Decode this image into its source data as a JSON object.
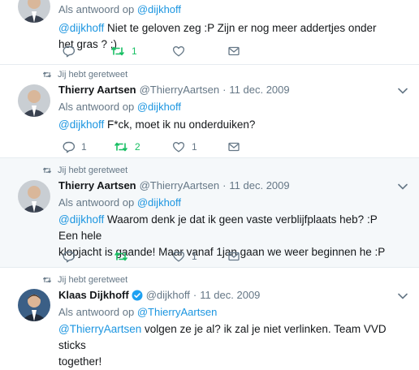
{
  "tweet1": {
    "reply_prefix": "Als antwoord op",
    "reply_handle": "@dijkhoff",
    "text_mention": "@dijkhoff",
    "text": "Niet te geloven zeg :P Zijn er nog meer addertjes onder het gras ? ;)",
    "retweet_count": "1"
  },
  "tweet2": {
    "retweeted_label": "Jij hebt geretweet",
    "name": "Thierry Aartsen",
    "handle": "@ThierryAartsen",
    "sep": "·",
    "date": "11 dec. 2009",
    "reply_prefix": "Als antwoord op",
    "reply_handle": "@dijkhoff",
    "text_mention": "@dijkhoff",
    "text": "F*ck, moet ik nu onderduiken?",
    "reply_count": "1",
    "retweet_count": "2",
    "like_count": "1"
  },
  "tweet3": {
    "retweeted_label": "Jij hebt geretweet",
    "name": "Thierry Aartsen",
    "handle": "@ThierryAartsen",
    "sep": "·",
    "date": "11 dec. 2009",
    "reply_prefix": "Als antwoord op",
    "reply_handle": "@dijkhoff",
    "text_mention": "@dijkhoff",
    "text_line1": "Waarom denk je dat ik geen vaste verblijfplaats heb? :P Een hele",
    "text_line2": "klopjacht is gaande! Maar vanaf 1jan gaan we weer beginnen he :P",
    "like_count": "1"
  },
  "tweet4": {
    "retweeted_label": "Jij hebt geretweet",
    "name": "Klaas Dijkhoff",
    "handle": "@dijkhoff",
    "sep": "·",
    "date": "11 dec. 2009",
    "reply_prefix": "Als antwoord op",
    "reply_handle": "@ThierryAartsen",
    "text_mention": "@ThierryAartsen",
    "text_line1": "volgen ze je al? ik zal je niet verlinken. Team VVD sticks",
    "text_line2": "together!"
  },
  "colors": {
    "link": "#1b95e0",
    "retweet_green": "#17bf63",
    "muted": "#657786"
  }
}
